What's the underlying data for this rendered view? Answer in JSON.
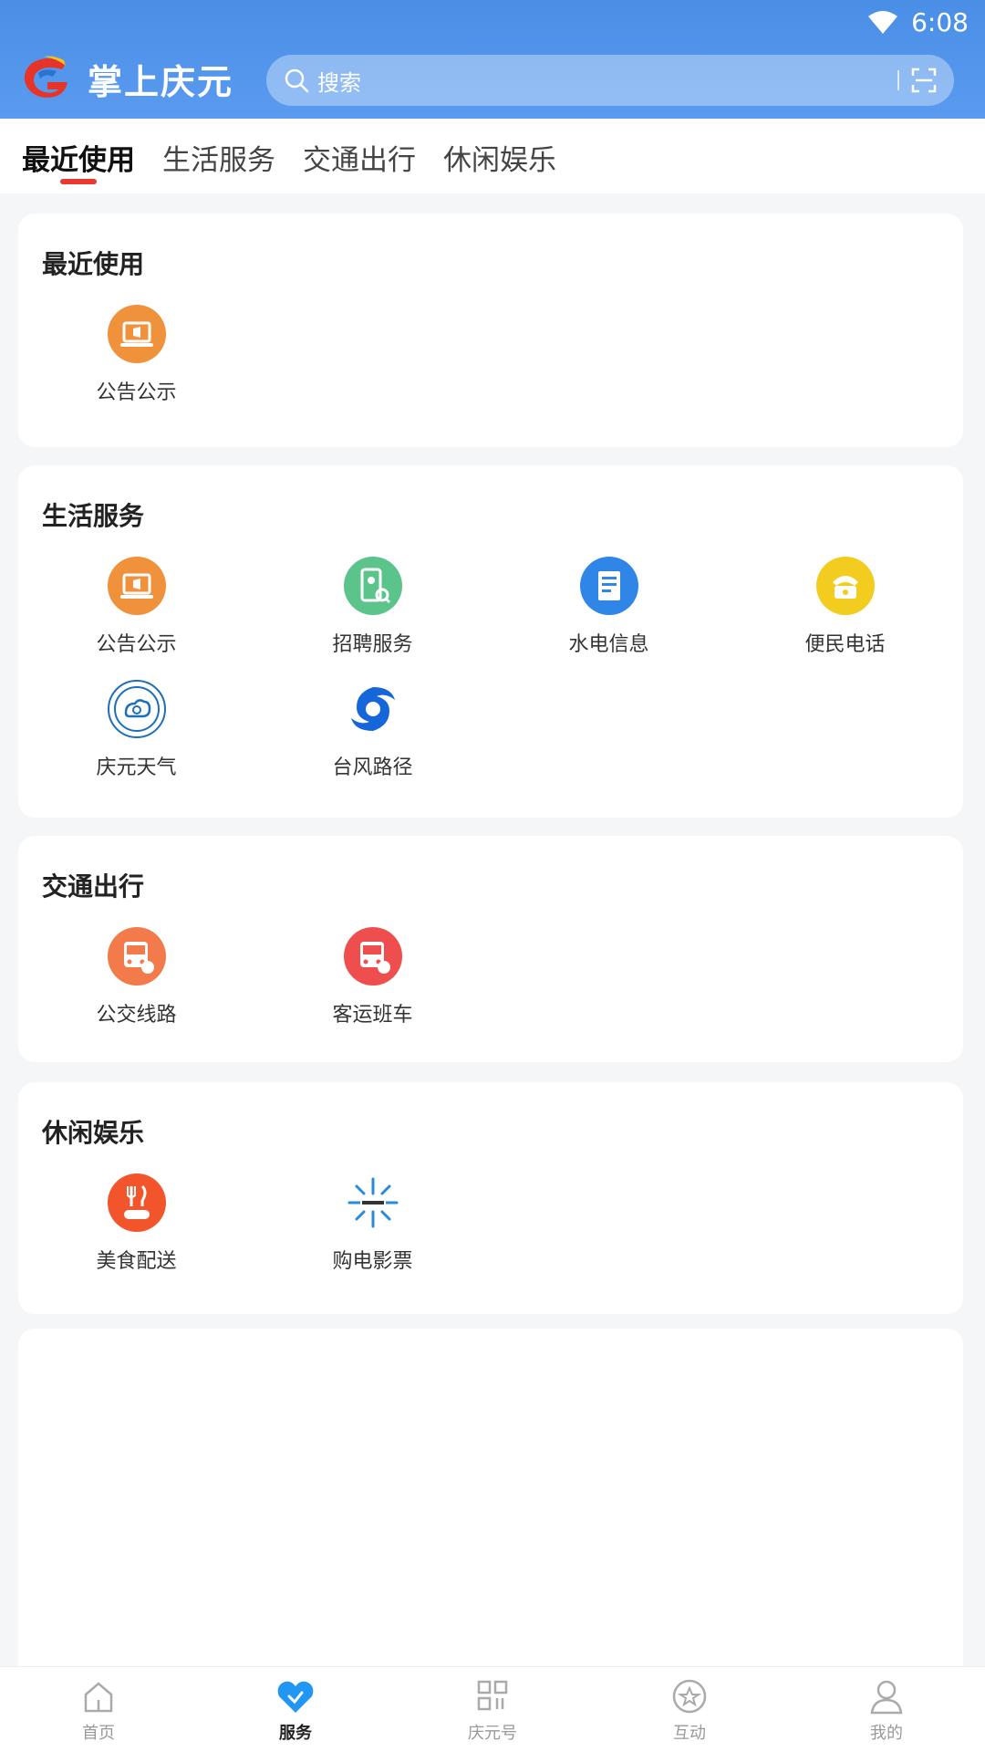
{
  "status": {
    "time": "6:08"
  },
  "header": {
    "app_name": "掌上庆元",
    "search_placeholder": "搜索"
  },
  "tabs": [
    {
      "label": "最近使用",
      "active": true
    },
    {
      "label": "生活服务",
      "active": false
    },
    {
      "label": "交通出行",
      "active": false
    },
    {
      "label": "休闲娱乐",
      "active": false
    }
  ],
  "sections": {
    "recent": {
      "title": "最近使用",
      "items": [
        {
          "label": "公告公示",
          "icon": "announcement-icon",
          "color": "#f0913c"
        }
      ]
    },
    "life": {
      "title": "生活服务",
      "items": [
        {
          "label": "公告公示",
          "icon": "announcement-icon",
          "color": "#f0913c"
        },
        {
          "label": "招聘服务",
          "icon": "recruitment-icon",
          "color": "#5bc48a"
        },
        {
          "label": "水电信息",
          "icon": "utility-info-icon",
          "color": "#2f86e6"
        },
        {
          "label": "便民电话",
          "icon": "phone-icon",
          "color": "#f2cc1f"
        },
        {
          "label": "庆元天气",
          "icon": "weather-icon",
          "color": "#1e6fb8"
        },
        {
          "label": "台风路径",
          "icon": "typhoon-icon",
          "color": "#1566d8"
        }
      ]
    },
    "transport": {
      "title": "交通出行",
      "items": [
        {
          "label": "公交线路",
          "icon": "bus-icon",
          "color": "#f37a4a"
        },
        {
          "label": "客运班车",
          "icon": "coach-icon",
          "color": "#ef4e4e"
        }
      ]
    },
    "leisure": {
      "title": "休闲娱乐",
      "items": [
        {
          "label": "美食配送",
          "icon": "food-delivery-icon",
          "color": "#f2552c"
        },
        {
          "label": "购电影票",
          "icon": "movie-ticket-icon",
          "color": "#2a8ad6"
        }
      ]
    }
  },
  "bottom_nav": [
    {
      "label": "首页",
      "icon": "home-icon",
      "active": false
    },
    {
      "label": "服务",
      "icon": "heart-icon",
      "active": true
    },
    {
      "label": "庆元号",
      "icon": "grid-icon",
      "active": false
    },
    {
      "label": "互动",
      "icon": "star-icon",
      "active": false
    },
    {
      "label": "我的",
      "icon": "user-icon",
      "active": false
    }
  ],
  "colors": {
    "header": "#4a8ee6",
    "accent_underline": "#e83a30",
    "nav_active": "#2196f3"
  }
}
